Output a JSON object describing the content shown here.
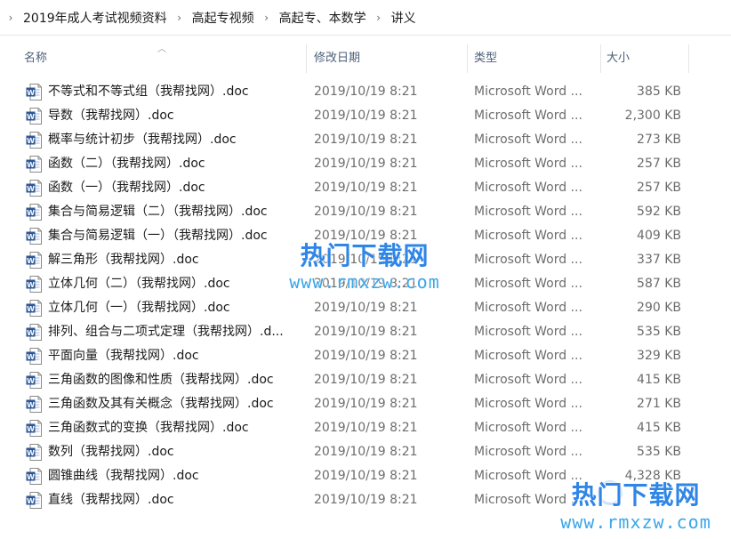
{
  "breadcrumb": {
    "items": [
      "2019年成人考试视频资料",
      "高起专视频",
      "高起专、本数学",
      "讲义"
    ]
  },
  "columns": {
    "name": "名称",
    "date": "修改日期",
    "type": "类型",
    "size": "大小"
  },
  "files": [
    {
      "name": "不等式和不等式组（我帮找网）.doc",
      "date": "2019/10/19 8:21",
      "type": "Microsoft Word ...",
      "size": "385 KB"
    },
    {
      "name": "导数（我帮找网）.doc",
      "date": "2019/10/19 8:21",
      "type": "Microsoft Word ...",
      "size": "2,300 KB"
    },
    {
      "name": "概率与统计初步（我帮找网）.doc",
      "date": "2019/10/19 8:21",
      "type": "Microsoft Word ...",
      "size": "273 KB"
    },
    {
      "name": "函数（二）（我帮找网）.doc",
      "date": "2019/10/19 8:21",
      "type": "Microsoft Word ...",
      "size": "257 KB"
    },
    {
      "name": "函数（一）（我帮找网）.doc",
      "date": "2019/10/19 8:21",
      "type": "Microsoft Word ...",
      "size": "257 KB"
    },
    {
      "name": "集合与简易逻辑（二）（我帮找网）.doc",
      "date": "2019/10/19 8:21",
      "type": "Microsoft Word ...",
      "size": "592 KB"
    },
    {
      "name": "集合与简易逻辑（一）（我帮找网）.doc",
      "date": "2019/10/19 8:21",
      "type": "Microsoft Word ...",
      "size": "409 KB"
    },
    {
      "name": "解三角形（我帮找网）.doc",
      "date": "2019/10/19 8:21",
      "type": "Microsoft Word ...",
      "size": "337 KB"
    },
    {
      "name": "立体几何（二）（我帮找网）.doc",
      "date": "2019/10/19 8:21",
      "type": "Microsoft Word ...",
      "size": "587 KB"
    },
    {
      "name": "立体几何（一）（我帮找网）.doc",
      "date": "2019/10/19 8:21",
      "type": "Microsoft Word ...",
      "size": "290 KB"
    },
    {
      "name": "排列、组合与二项式定理（我帮找网）.d...",
      "date": "2019/10/19 8:21",
      "type": "Microsoft Word ...",
      "size": "535 KB"
    },
    {
      "name": "平面向量（我帮找网）.doc",
      "date": "2019/10/19 8:21",
      "type": "Microsoft Word ...",
      "size": "329 KB"
    },
    {
      "name": "三角函数的图像和性质（我帮找网）.doc",
      "date": "2019/10/19 8:21",
      "type": "Microsoft Word ...",
      "size": "415 KB"
    },
    {
      "name": "三角函数及其有关概念（我帮找网）.doc",
      "date": "2019/10/19 8:21",
      "type": "Microsoft Word ...",
      "size": "271 KB"
    },
    {
      "name": "三角函数式的变换（我帮找网）.doc",
      "date": "2019/10/19 8:21",
      "type": "Microsoft Word ...",
      "size": "415 KB"
    },
    {
      "name": "数列（我帮找网）.doc",
      "date": "2019/10/19 8:21",
      "type": "Microsoft Word ...",
      "size": "535 KB"
    },
    {
      "name": "圆锥曲线（我帮找网）.doc",
      "date": "2019/10/19 8:21",
      "type": "Microsoft Word ...",
      "size": "4,328 KB"
    },
    {
      "name": "直线（我帮找网）.doc",
      "date": "2019/10/19 8:21",
      "type": "Microsoft Word ...",
      "size": ""
    }
  ],
  "watermark": {
    "title": "热门下载网",
    "url": "www.rmxzw.com"
  },
  "colors": {
    "word_icon": "#2b5797",
    "header_text": "#4c607a",
    "watermark": "#2f86e6"
  },
  "icons": {
    "file": "word-document-icon",
    "breadcrumb_separator": "chevron-right-icon",
    "sort": "sort-ascending-icon"
  }
}
